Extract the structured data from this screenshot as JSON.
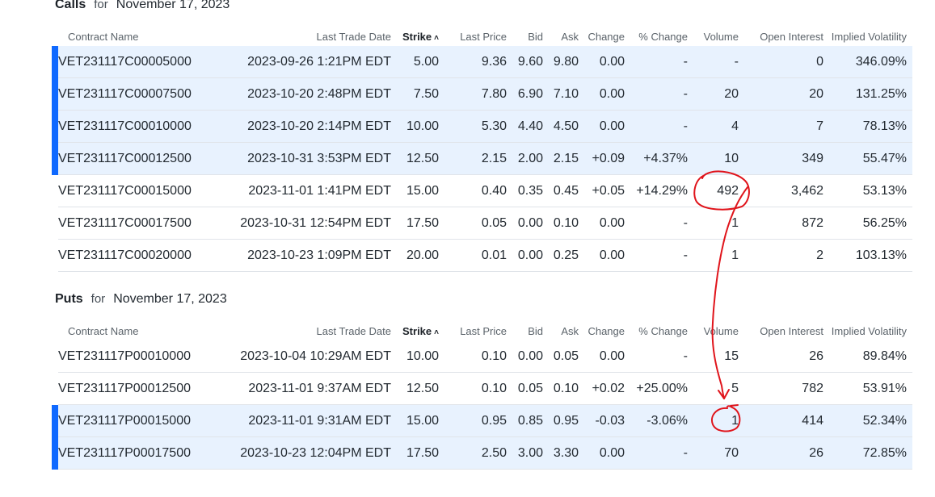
{
  "calls": {
    "title": "Calls",
    "for_label": "for",
    "date": "November 17, 2023",
    "headers": [
      "Contract Name",
      "Last Trade Date",
      "Strike",
      "Last Price",
      "Bid",
      "Ask",
      "Change",
      "% Change",
      "Volume",
      "Open Interest",
      "Implied Volatility"
    ],
    "sort_icon": "chevron-up-icon",
    "rows": [
      {
        "contract": "VET231117C00005000",
        "last_trade": "2023-09-26 1:21PM EDT",
        "strike": "5.00",
        "last_price": "9.36",
        "bid": "9.60",
        "ask": "9.80",
        "change": "0.00",
        "pct_change": "-",
        "volume": "-",
        "open_interest": "0",
        "iv": "346.09%",
        "in_the_money": true,
        "trend": "flat"
      },
      {
        "contract": "VET231117C00007500",
        "last_trade": "2023-10-20 2:48PM EDT",
        "strike": "7.50",
        "last_price": "7.80",
        "bid": "6.90",
        "ask": "7.10",
        "change": "0.00",
        "pct_change": "-",
        "volume": "20",
        "open_interest": "20",
        "iv": "131.25%",
        "in_the_money": true,
        "trend": "flat"
      },
      {
        "contract": "VET231117C00010000",
        "last_trade": "2023-10-20 2:14PM EDT",
        "strike": "10.00",
        "last_price": "5.30",
        "bid": "4.40",
        "ask": "4.50",
        "change": "0.00",
        "pct_change": "-",
        "volume": "4",
        "open_interest": "7",
        "iv": "78.13%",
        "in_the_money": true,
        "trend": "flat"
      },
      {
        "contract": "VET231117C00012500",
        "last_trade": "2023-10-31 3:53PM EDT",
        "strike": "12.50",
        "last_price": "2.15",
        "bid": "2.00",
        "ask": "2.15",
        "change": "+0.09",
        "pct_change": "+4.37%",
        "volume": "10",
        "open_interest": "349",
        "iv": "55.47%",
        "in_the_money": true,
        "trend": "pos"
      },
      {
        "contract": "VET231117C00015000",
        "last_trade": "2023-11-01 1:41PM EDT",
        "strike": "15.00",
        "last_price": "0.40",
        "bid": "0.35",
        "ask": "0.45",
        "change": "+0.05",
        "pct_change": "+14.29%",
        "volume": "492",
        "open_interest": "3,462",
        "iv": "53.13%",
        "in_the_money": false,
        "trend": "pos"
      },
      {
        "contract": "VET231117C00017500",
        "last_trade": "2023-10-31 12:54PM EDT",
        "strike": "17.50",
        "last_price": "0.05",
        "bid": "0.00",
        "ask": "0.10",
        "change": "0.00",
        "pct_change": "-",
        "volume": "1",
        "open_interest": "872",
        "iv": "56.25%",
        "in_the_money": false,
        "trend": "flat"
      },
      {
        "contract": "VET231117C00020000",
        "last_trade": "2023-10-23 1:09PM EDT",
        "strike": "20.00",
        "last_price": "0.01",
        "bid": "0.00",
        "ask": "0.25",
        "change": "0.00",
        "pct_change": "-",
        "volume": "1",
        "open_interest": "2",
        "iv": "103.13%",
        "in_the_money": false,
        "trend": "flat"
      }
    ]
  },
  "puts": {
    "title": "Puts",
    "for_label": "for",
    "date": "November 17, 2023",
    "headers": [
      "Contract Name",
      "Last Trade Date",
      "Strike",
      "Last Price",
      "Bid",
      "Ask",
      "Change",
      "% Change",
      "Volume",
      "Open Interest",
      "Implied Volatility"
    ],
    "sort_icon": "chevron-up-icon",
    "rows": [
      {
        "contract": "VET231117P00010000",
        "last_trade": "2023-10-04 10:29AM EDT",
        "strike": "10.00",
        "last_price": "0.10",
        "bid": "0.00",
        "ask": "0.05",
        "change": "0.00",
        "pct_change": "-",
        "volume": "15",
        "open_interest": "26",
        "iv": "89.84%",
        "in_the_money": false,
        "trend": "flat"
      },
      {
        "contract": "VET231117P00012500",
        "last_trade": "2023-11-01 9:37AM EDT",
        "strike": "12.50",
        "last_price": "0.10",
        "bid": "0.05",
        "ask": "0.10",
        "change": "+0.02",
        "pct_change": "+25.00%",
        "volume": "5",
        "open_interest": "782",
        "iv": "53.91%",
        "in_the_money": false,
        "trend": "pos"
      },
      {
        "contract": "VET231117P00015000",
        "last_trade": "2023-11-01 9:31AM EDT",
        "strike": "15.00",
        "last_price": "0.95",
        "bid": "0.85",
        "ask": "0.95",
        "change": "-0.03",
        "pct_change": "-3.06%",
        "volume": "1",
        "open_interest": "414",
        "iv": "52.34%",
        "in_the_money": true,
        "trend": "neg"
      },
      {
        "contract": "VET231117P00017500",
        "last_trade": "2023-10-23 12:04PM EDT",
        "strike": "17.50",
        "last_price": "2.50",
        "bid": "3.00",
        "ask": "3.30",
        "change": "0.00",
        "pct_change": "-",
        "volume": "70",
        "open_interest": "26",
        "iv": "72.85%",
        "in_the_money": true,
        "trend": "flat"
      }
    ]
  },
  "colors": {
    "link": "#0f69ff",
    "in_the_money_row": "#e8f2fe",
    "in_the_money_marker": "#0f69ff",
    "positive": "#008a3b",
    "negative": "#cc0b11",
    "annotation": "#e0141b"
  }
}
